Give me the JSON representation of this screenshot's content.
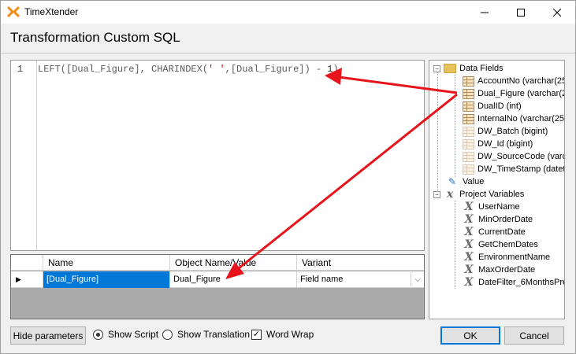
{
  "window": {
    "title": "TimeXtender"
  },
  "dialog": {
    "title": "Transformation Custom SQL"
  },
  "editor": {
    "line_number": "1",
    "code_parts": [
      "LEFT([Dual_Figure], CHARINDEX(",
      "' '",
      ",[Dual_Figure]) - ",
      "1",
      ")"
    ]
  },
  "tree": {
    "data_fields_label": "Data Fields",
    "fields": [
      "AccountNo (varchar(25",
      "Dual_Figure (varchar(2",
      "DualID (int)",
      "InternalNo (varchar(25",
      "DW_Batch (bigint)",
      "DW_Id (bigint)",
      "DW_SourceCode (varc",
      "DW_TimeStamp (datet"
    ],
    "value_label": "Value",
    "project_variables_label": "Project Variables",
    "variables": [
      "UserName",
      "MinOrderDate",
      "CurrentDate",
      "GetChemDates",
      "EnvironmentName",
      "MaxOrderDate",
      "DateFilter_6MonthsPre"
    ]
  },
  "grid": {
    "columns": [
      "Name",
      "Object Name/Value",
      "Variant"
    ],
    "rows": [
      {
        "name": "[Dual_Figure]",
        "object": "Dual_Figure",
        "variant": "Field name"
      }
    ]
  },
  "footer": {
    "hide_parameters": "Hide parameters",
    "show_script": "Show Script",
    "show_translation": "Show Translation",
    "word_wrap": "Word Wrap",
    "ok": "OK",
    "cancel": "Cancel"
  },
  "colors": {
    "accent": "#0078d7",
    "annotation_arrow": "#e8141b"
  }
}
